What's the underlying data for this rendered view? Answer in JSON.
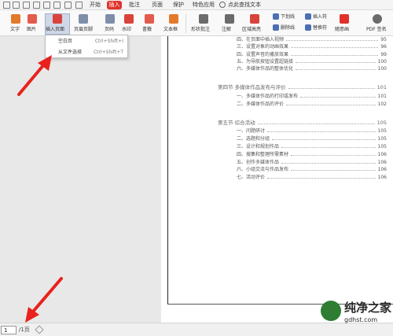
{
  "tabs": [
    {
      "label": "开始",
      "active": false
    },
    {
      "label": "插入",
      "active": true
    },
    {
      "label": "批注",
      "active": false
    },
    {
      "label": "页面",
      "active": false
    },
    {
      "label": "保护",
      "active": false
    },
    {
      "label": "特色应用",
      "active": false
    }
  ],
  "search": {
    "label": "点此查找文本"
  },
  "ribbon": {
    "text": "文字",
    "picture": "图片",
    "insert_page": "插入页面",
    "header_footer": "页眉页脚",
    "page_number": "页码",
    "watermark": "水印",
    "bookmark": "書籤",
    "textbox": "文本框",
    "shape_comment": "形状批注",
    "annotation": "注解",
    "area_highlight": "区域高亮",
    "underline": "下划线",
    "strikethrough": "删除线",
    "insert_symbol": "插入符",
    "replace_symbol": "替换符",
    "sign": "随意画",
    "pdf_sign": "PDF 签名"
  },
  "dropdown": {
    "items": [
      {
        "label": "空白页",
        "shortcut": "Ctrl+Shift+I"
      },
      {
        "label": "从文件选择",
        "shortcut": "Ctrl+Shift+T"
      }
    ]
  },
  "toc": [
    {
      "text": "四、在页面中插入视频",
      "page": "95",
      "head": false
    },
    {
      "text": "三、设置对象的动画效果",
      "page": "96",
      "head": false
    },
    {
      "text": "四、设置声音的播放效果",
      "page": "99",
      "head": false
    },
    {
      "text": "五、为导航按钮设置超链接",
      "page": "100",
      "head": false
    },
    {
      "text": "六、多媒体作品的整体优化",
      "page": "100",
      "head": false
    },
    {
      "text": "第四节  多媒体作品发布与评价",
      "page": "101",
      "head": true
    },
    {
      "text": "一、多媒体作品的打印或发布",
      "page": "101",
      "head": false
    },
    {
      "text": "二、多媒体作品的评价",
      "page": "102",
      "head": false
    },
    {
      "text": "第五节  综合活动",
      "page": "105",
      "head": true
    },
    {
      "text": "一、问题研讨",
      "page": "105",
      "head": false
    },
    {
      "text": "二、选题和分组",
      "page": "105",
      "head": false
    },
    {
      "text": "三、设计和规划作品",
      "page": "105",
      "head": false
    },
    {
      "text": "四、搜集和整理所需素材",
      "page": "106",
      "head": false
    },
    {
      "text": "五、创作多媒体作品",
      "page": "106",
      "head": false
    },
    {
      "text": "六、小组交流与作品发布",
      "page": "106",
      "head": false
    },
    {
      "text": "七、活动评价",
      "page": "106",
      "head": false
    }
  ],
  "status": {
    "page_input": "1",
    "page_total": "/1页"
  },
  "watermark": {
    "name": "纯净之家",
    "url": "gdhst.com"
  },
  "colors": {
    "accent": "#e0322b",
    "arrow": "#e8221c",
    "ribbon_highlight": "#cfd8e6"
  }
}
